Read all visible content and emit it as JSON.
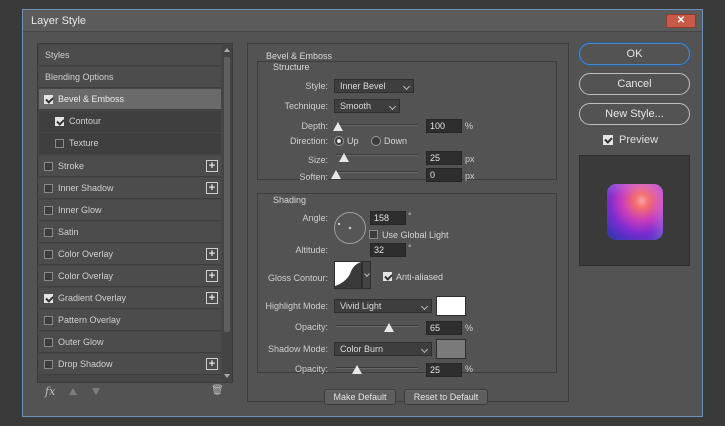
{
  "window": {
    "title": "Layer Style",
    "close_glyph": "✕"
  },
  "left_list": [
    {
      "label": "Styles",
      "checkbox": null,
      "plus": false,
      "state": "normal"
    },
    {
      "label": "Blending Options",
      "checkbox": null,
      "plus": false,
      "state": "normal"
    },
    {
      "label": "Bevel & Emboss",
      "checkbox": true,
      "plus": false,
      "state": "selected"
    },
    {
      "label": "Contour",
      "checkbox": true,
      "plus": false,
      "state": "sub"
    },
    {
      "label": "Texture",
      "checkbox": false,
      "plus": false,
      "state": "sub"
    },
    {
      "label": "Stroke",
      "checkbox": false,
      "plus": true,
      "state": "normal"
    },
    {
      "label": "Inner Shadow",
      "checkbox": false,
      "plus": true,
      "state": "normal"
    },
    {
      "label": "Inner Glow",
      "checkbox": false,
      "plus": false,
      "state": "normal"
    },
    {
      "label": "Satin",
      "checkbox": false,
      "plus": false,
      "state": "normal"
    },
    {
      "label": "Color Overlay",
      "checkbox": false,
      "plus": true,
      "state": "normal"
    },
    {
      "label": "Color Overlay",
      "checkbox": false,
      "plus": true,
      "state": "normal"
    },
    {
      "label": "Gradient Overlay",
      "checkbox": true,
      "plus": true,
      "state": "normal"
    },
    {
      "label": "Pattern Overlay",
      "checkbox": false,
      "plus": false,
      "state": "normal"
    },
    {
      "label": "Outer Glow",
      "checkbox": false,
      "plus": false,
      "state": "normal"
    },
    {
      "label": "Drop Shadow",
      "checkbox": false,
      "plus": true,
      "state": "normal"
    }
  ],
  "left_toolbar": {
    "fx_label": "fx",
    "trash_glyph": "🗑"
  },
  "bevel": {
    "section_title": "Bevel & Emboss",
    "structure": {
      "title": "Structure",
      "style_label": "Style:",
      "style_value": "Inner Bevel",
      "technique_label": "Technique:",
      "technique_value": "Smooth",
      "depth_label": "Depth:",
      "depth_value": "100",
      "depth_unit": "%",
      "depth_slider": 0.03,
      "direction_label": "Direction:",
      "direction_up": "Up",
      "direction_down": "Down",
      "direction_selected": "Up",
      "size_label": "Size:",
      "size_value": "25",
      "size_unit": "px",
      "size_slider": 0.1,
      "soften_label": "Soften:",
      "soften_value": "0",
      "soften_unit": "px",
      "soften_slider": 0.0
    },
    "shading": {
      "title": "Shading",
      "angle_label": "Angle:",
      "angle_value": "158",
      "angle_unit": "°",
      "global_light_label": "Use Global Light",
      "global_light_checked": false,
      "altitude_label": "Altitude:",
      "altitude_value": "32",
      "altitude_unit": "°",
      "gloss_label": "Gloss Contour:",
      "anti_aliased_label": "Anti-aliased",
      "anti_aliased_checked": true,
      "highlight_label": "Highlight Mode:",
      "highlight_mode": "Vivid Light",
      "highlight_color": "#ffffff",
      "highlight_opacity_label": "Opacity:",
      "highlight_opacity": "65",
      "highlight_opacity_unit": "%",
      "highlight_opacity_slider": 0.65,
      "shadow_label": "Shadow Mode:",
      "shadow_mode": "Color Burn",
      "shadow_color": "#7a7a7a",
      "shadow_opacity_label": "Opacity:",
      "shadow_opacity": "25",
      "shadow_opacity_unit": "%",
      "shadow_opacity_slider": 0.25
    },
    "make_default": "Make Default",
    "reset_default": "Reset to Default"
  },
  "buttons": {
    "ok": "OK",
    "cancel": "Cancel",
    "new_style": "New Style..."
  },
  "preview": {
    "label": "Preview",
    "checked": true
  }
}
